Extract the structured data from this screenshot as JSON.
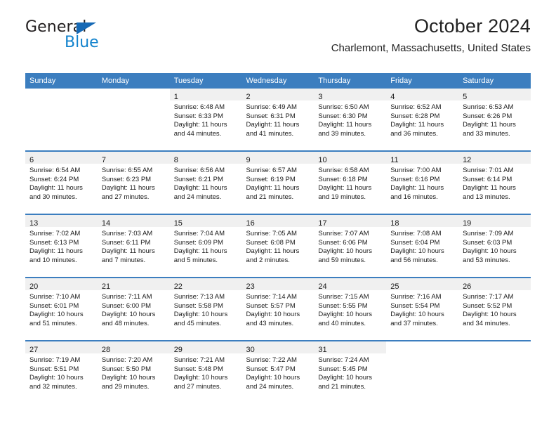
{
  "brand": {
    "name_top": "General",
    "name_bottom": "Blue",
    "accent_color": "#1383cd",
    "triangle_color": "#1669b5"
  },
  "header": {
    "title": "October 2024",
    "subtitle": "Charlemont, Massachusetts, United States"
  },
  "calendar": {
    "header_bg": "#3c7ebf",
    "daynum_band_bg": "#f0f0f0",
    "weekday_headers": [
      "Sunday",
      "Monday",
      "Tuesday",
      "Wednesday",
      "Thursday",
      "Friday",
      "Saturday"
    ],
    "weeks": [
      [
        {
          "day": "",
          "sunrise": "",
          "sunset": "",
          "daylight_1": "",
          "daylight_2": ""
        },
        {
          "day": "",
          "sunrise": "",
          "sunset": "",
          "daylight_1": "",
          "daylight_2": ""
        },
        {
          "day": "1",
          "sunrise": "Sunrise: 6:48 AM",
          "sunset": "Sunset: 6:33 PM",
          "daylight_1": "Daylight: 11 hours",
          "daylight_2": "and 44 minutes."
        },
        {
          "day": "2",
          "sunrise": "Sunrise: 6:49 AM",
          "sunset": "Sunset: 6:31 PM",
          "daylight_1": "Daylight: 11 hours",
          "daylight_2": "and 41 minutes."
        },
        {
          "day": "3",
          "sunrise": "Sunrise: 6:50 AM",
          "sunset": "Sunset: 6:30 PM",
          "daylight_1": "Daylight: 11 hours",
          "daylight_2": "and 39 minutes."
        },
        {
          "day": "4",
          "sunrise": "Sunrise: 6:52 AM",
          "sunset": "Sunset: 6:28 PM",
          "daylight_1": "Daylight: 11 hours",
          "daylight_2": "and 36 minutes."
        },
        {
          "day": "5",
          "sunrise": "Sunrise: 6:53 AM",
          "sunset": "Sunset: 6:26 PM",
          "daylight_1": "Daylight: 11 hours",
          "daylight_2": "and 33 minutes."
        }
      ],
      [
        {
          "day": "6",
          "sunrise": "Sunrise: 6:54 AM",
          "sunset": "Sunset: 6:24 PM",
          "daylight_1": "Daylight: 11 hours",
          "daylight_2": "and 30 minutes."
        },
        {
          "day": "7",
          "sunrise": "Sunrise: 6:55 AM",
          "sunset": "Sunset: 6:23 PM",
          "daylight_1": "Daylight: 11 hours",
          "daylight_2": "and 27 minutes."
        },
        {
          "day": "8",
          "sunrise": "Sunrise: 6:56 AM",
          "sunset": "Sunset: 6:21 PM",
          "daylight_1": "Daylight: 11 hours",
          "daylight_2": "and 24 minutes."
        },
        {
          "day": "9",
          "sunrise": "Sunrise: 6:57 AM",
          "sunset": "Sunset: 6:19 PM",
          "daylight_1": "Daylight: 11 hours",
          "daylight_2": "and 21 minutes."
        },
        {
          "day": "10",
          "sunrise": "Sunrise: 6:58 AM",
          "sunset": "Sunset: 6:18 PM",
          "daylight_1": "Daylight: 11 hours",
          "daylight_2": "and 19 minutes."
        },
        {
          "day": "11",
          "sunrise": "Sunrise: 7:00 AM",
          "sunset": "Sunset: 6:16 PM",
          "daylight_1": "Daylight: 11 hours",
          "daylight_2": "and 16 minutes."
        },
        {
          "day": "12",
          "sunrise": "Sunrise: 7:01 AM",
          "sunset": "Sunset: 6:14 PM",
          "daylight_1": "Daylight: 11 hours",
          "daylight_2": "and 13 minutes."
        }
      ],
      [
        {
          "day": "13",
          "sunrise": "Sunrise: 7:02 AM",
          "sunset": "Sunset: 6:13 PM",
          "daylight_1": "Daylight: 11 hours",
          "daylight_2": "and 10 minutes."
        },
        {
          "day": "14",
          "sunrise": "Sunrise: 7:03 AM",
          "sunset": "Sunset: 6:11 PM",
          "daylight_1": "Daylight: 11 hours",
          "daylight_2": "and 7 minutes."
        },
        {
          "day": "15",
          "sunrise": "Sunrise: 7:04 AM",
          "sunset": "Sunset: 6:09 PM",
          "daylight_1": "Daylight: 11 hours",
          "daylight_2": "and 5 minutes."
        },
        {
          "day": "16",
          "sunrise": "Sunrise: 7:05 AM",
          "sunset": "Sunset: 6:08 PM",
          "daylight_1": "Daylight: 11 hours",
          "daylight_2": "and 2 minutes."
        },
        {
          "day": "17",
          "sunrise": "Sunrise: 7:07 AM",
          "sunset": "Sunset: 6:06 PM",
          "daylight_1": "Daylight: 10 hours",
          "daylight_2": "and 59 minutes."
        },
        {
          "day": "18",
          "sunrise": "Sunrise: 7:08 AM",
          "sunset": "Sunset: 6:04 PM",
          "daylight_1": "Daylight: 10 hours",
          "daylight_2": "and 56 minutes."
        },
        {
          "day": "19",
          "sunrise": "Sunrise: 7:09 AM",
          "sunset": "Sunset: 6:03 PM",
          "daylight_1": "Daylight: 10 hours",
          "daylight_2": "and 53 minutes."
        }
      ],
      [
        {
          "day": "20",
          "sunrise": "Sunrise: 7:10 AM",
          "sunset": "Sunset: 6:01 PM",
          "daylight_1": "Daylight: 10 hours",
          "daylight_2": "and 51 minutes."
        },
        {
          "day": "21",
          "sunrise": "Sunrise: 7:11 AM",
          "sunset": "Sunset: 6:00 PM",
          "daylight_1": "Daylight: 10 hours",
          "daylight_2": "and 48 minutes."
        },
        {
          "day": "22",
          "sunrise": "Sunrise: 7:13 AM",
          "sunset": "Sunset: 5:58 PM",
          "daylight_1": "Daylight: 10 hours",
          "daylight_2": "and 45 minutes."
        },
        {
          "day": "23",
          "sunrise": "Sunrise: 7:14 AM",
          "sunset": "Sunset: 5:57 PM",
          "daylight_1": "Daylight: 10 hours",
          "daylight_2": "and 43 minutes."
        },
        {
          "day": "24",
          "sunrise": "Sunrise: 7:15 AM",
          "sunset": "Sunset: 5:55 PM",
          "daylight_1": "Daylight: 10 hours",
          "daylight_2": "and 40 minutes."
        },
        {
          "day": "25",
          "sunrise": "Sunrise: 7:16 AM",
          "sunset": "Sunset: 5:54 PM",
          "daylight_1": "Daylight: 10 hours",
          "daylight_2": "and 37 minutes."
        },
        {
          "day": "26",
          "sunrise": "Sunrise: 7:17 AM",
          "sunset": "Sunset: 5:52 PM",
          "daylight_1": "Daylight: 10 hours",
          "daylight_2": "and 34 minutes."
        }
      ],
      [
        {
          "day": "27",
          "sunrise": "Sunrise: 7:19 AM",
          "sunset": "Sunset: 5:51 PM",
          "daylight_1": "Daylight: 10 hours",
          "daylight_2": "and 32 minutes."
        },
        {
          "day": "28",
          "sunrise": "Sunrise: 7:20 AM",
          "sunset": "Sunset: 5:50 PM",
          "daylight_1": "Daylight: 10 hours",
          "daylight_2": "and 29 minutes."
        },
        {
          "day": "29",
          "sunrise": "Sunrise: 7:21 AM",
          "sunset": "Sunset: 5:48 PM",
          "daylight_1": "Daylight: 10 hours",
          "daylight_2": "and 27 minutes."
        },
        {
          "day": "30",
          "sunrise": "Sunrise: 7:22 AM",
          "sunset": "Sunset: 5:47 PM",
          "daylight_1": "Daylight: 10 hours",
          "daylight_2": "and 24 minutes."
        },
        {
          "day": "31",
          "sunrise": "Sunrise: 7:24 AM",
          "sunset": "Sunset: 5:45 PM",
          "daylight_1": "Daylight: 10 hours",
          "daylight_2": "and 21 minutes."
        },
        {
          "day": "",
          "sunrise": "",
          "sunset": "",
          "daylight_1": "",
          "daylight_2": ""
        },
        {
          "day": "",
          "sunrise": "",
          "sunset": "",
          "daylight_1": "",
          "daylight_2": ""
        }
      ]
    ]
  }
}
